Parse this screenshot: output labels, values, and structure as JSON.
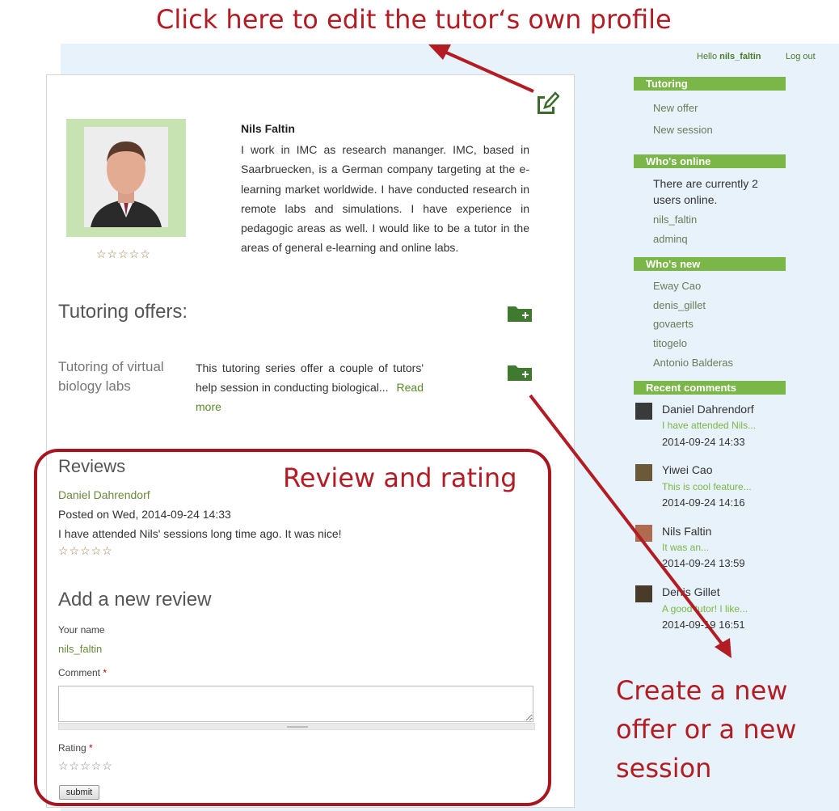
{
  "annotations": {
    "edit_profile": "Click here to edit the tutor‘s own profile",
    "review_rating": "Review and rating",
    "create_offer": "Create a new offer or a new session"
  },
  "header": {
    "hello_prefix": "Hello",
    "username": "nils_faltin",
    "logout": "Log out"
  },
  "profile": {
    "name": "Nils Faltin",
    "bio": "I work in IMC as research mananger. IMC, based in Saarbruecken, is a German company targeting at the e-learning market worldwide. I have conducted research in remote labs and simulations. I have experience in pedagogic areas as well. I would like to be a tutor in the areas of general e-learning and online labs.",
    "rating_stars": "☆☆☆☆☆",
    "edit_icon": "edit-icon"
  },
  "offers": {
    "heading": "Tutoring offers:",
    "items": [
      {
        "title": "Tutoring of virtual biology labs",
        "description": "This tutoring series offer a couple of tutors' help session in conducting biological...",
        "read_more": "Read more"
      }
    ]
  },
  "reviews": {
    "heading": "Reviews",
    "items": [
      {
        "author": "Daniel Dahrendorf",
        "posted": "Posted on Wed, 2014-09-24 14:33",
        "text": "I have attended Nils' sessions long time ago. It was nice!",
        "stars": "☆☆☆☆☆"
      }
    ]
  },
  "new_review": {
    "heading": "Add a new review",
    "your_name_label": "Your name",
    "your_name_value": "nils_faltin",
    "comment_label": "Comment",
    "required_mark": "*",
    "rating_label": "Rating",
    "rating_stars": "☆☆☆☆☆",
    "submit": "submit"
  },
  "sidebar": {
    "tutoring": {
      "heading": "Tutoring",
      "links": [
        "New offer",
        "New session"
      ]
    },
    "whos_online": {
      "heading": "Who's online",
      "text": "There are currently 2 users online.",
      "users": [
        "nils_faltin",
        "adminq"
      ]
    },
    "whos_new": {
      "heading": "Who's new",
      "users": [
        "Eway Cao",
        "denis_gillet",
        "govaerts",
        "titogelo",
        "Antonio Balderas"
      ]
    },
    "recent_comments": {
      "heading": "Recent comments",
      "items": [
        {
          "name": "Daniel Dahrendorf",
          "snippet": "I have attended Nils...",
          "date": "2014-09-24 14:33"
        },
        {
          "name": "Yiwei Cao",
          "snippet": "This is cool feature...",
          "date": "2014-09-24 14:16"
        },
        {
          "name": "Nils Faltin",
          "snippet": "It was an...",
          "date": "2014-09-24 13:59"
        },
        {
          "name": "Denis Gillet",
          "snippet": "A good tutor! I like...",
          "date": "2014-09-19 16:51"
        }
      ]
    }
  },
  "colors": {
    "accent_green": "#7ab648",
    "annotation_red": "#b41c24"
  }
}
